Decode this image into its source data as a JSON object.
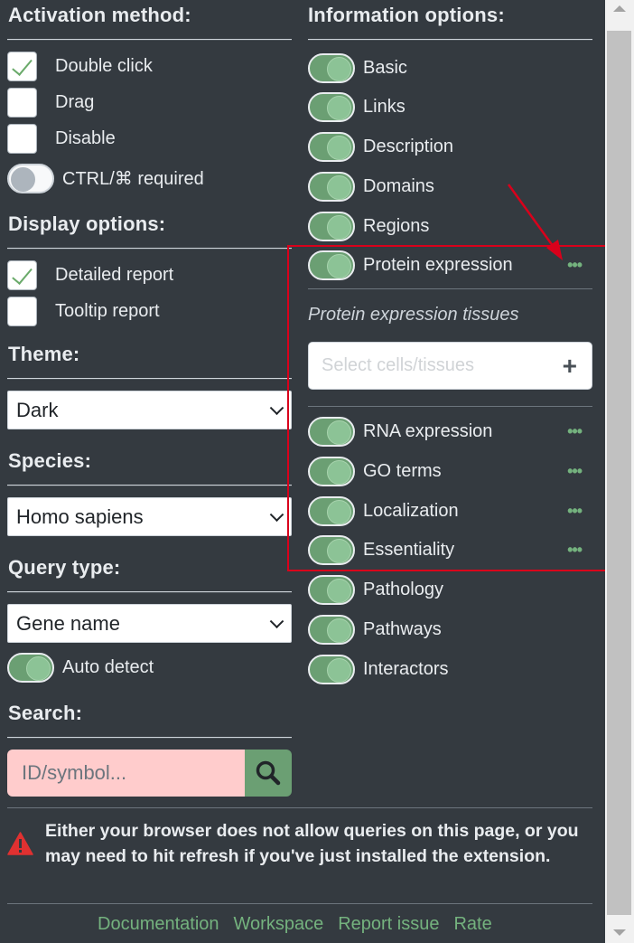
{
  "activation": {
    "heading": "Activation method:",
    "options": [
      {
        "label": "Double click",
        "checked": true
      },
      {
        "label": "Drag",
        "checked": false
      },
      {
        "label": "Disable",
        "checked": false
      }
    ],
    "ctrl_label": "CTRL/⌘ required"
  },
  "display": {
    "heading": "Display options:",
    "options": [
      {
        "label": "Detailed report",
        "checked": true
      },
      {
        "label": "Tooltip report",
        "checked": false
      }
    ]
  },
  "theme": {
    "heading": "Theme:",
    "value": "Dark"
  },
  "species": {
    "heading": "Species:",
    "value": "Homo sapiens"
  },
  "query_type": {
    "heading": "Query type:",
    "value": "Gene name",
    "auto_detect_label": "Auto detect"
  },
  "search": {
    "heading": "Search:",
    "placeholder": "ID/symbol..."
  },
  "info": {
    "heading": "Information options:",
    "items": [
      {
        "label": "Basic"
      },
      {
        "label": "Links"
      },
      {
        "label": "Description"
      },
      {
        "label": "Domains"
      },
      {
        "label": "Regions"
      },
      {
        "label": "Protein expression"
      },
      {
        "label": "RNA expression"
      },
      {
        "label": "GO terms"
      },
      {
        "label": "Localization"
      },
      {
        "label": "Essentiality"
      },
      {
        "label": "Pathology"
      },
      {
        "label": "Pathways"
      },
      {
        "label": "Interactors"
      }
    ],
    "tissues_subtitle": "Protein expression tissues",
    "tissues_placeholder": "Select cells/tissues",
    "plus_symbol": "+",
    "more_symbol": "•••"
  },
  "warning": {
    "text": "Either your browser does not allow queries on this page, or you may need to hit refresh if you've just installed the extension."
  },
  "footer": {
    "links": [
      "Documentation",
      "Workspace",
      "Report issue",
      "Rate"
    ]
  },
  "colors": {
    "background": "#343a40",
    "accent": "#6b9f73",
    "link": "#74b27e",
    "highlight": "#d9001b",
    "search_bg": "#ffcccc"
  }
}
